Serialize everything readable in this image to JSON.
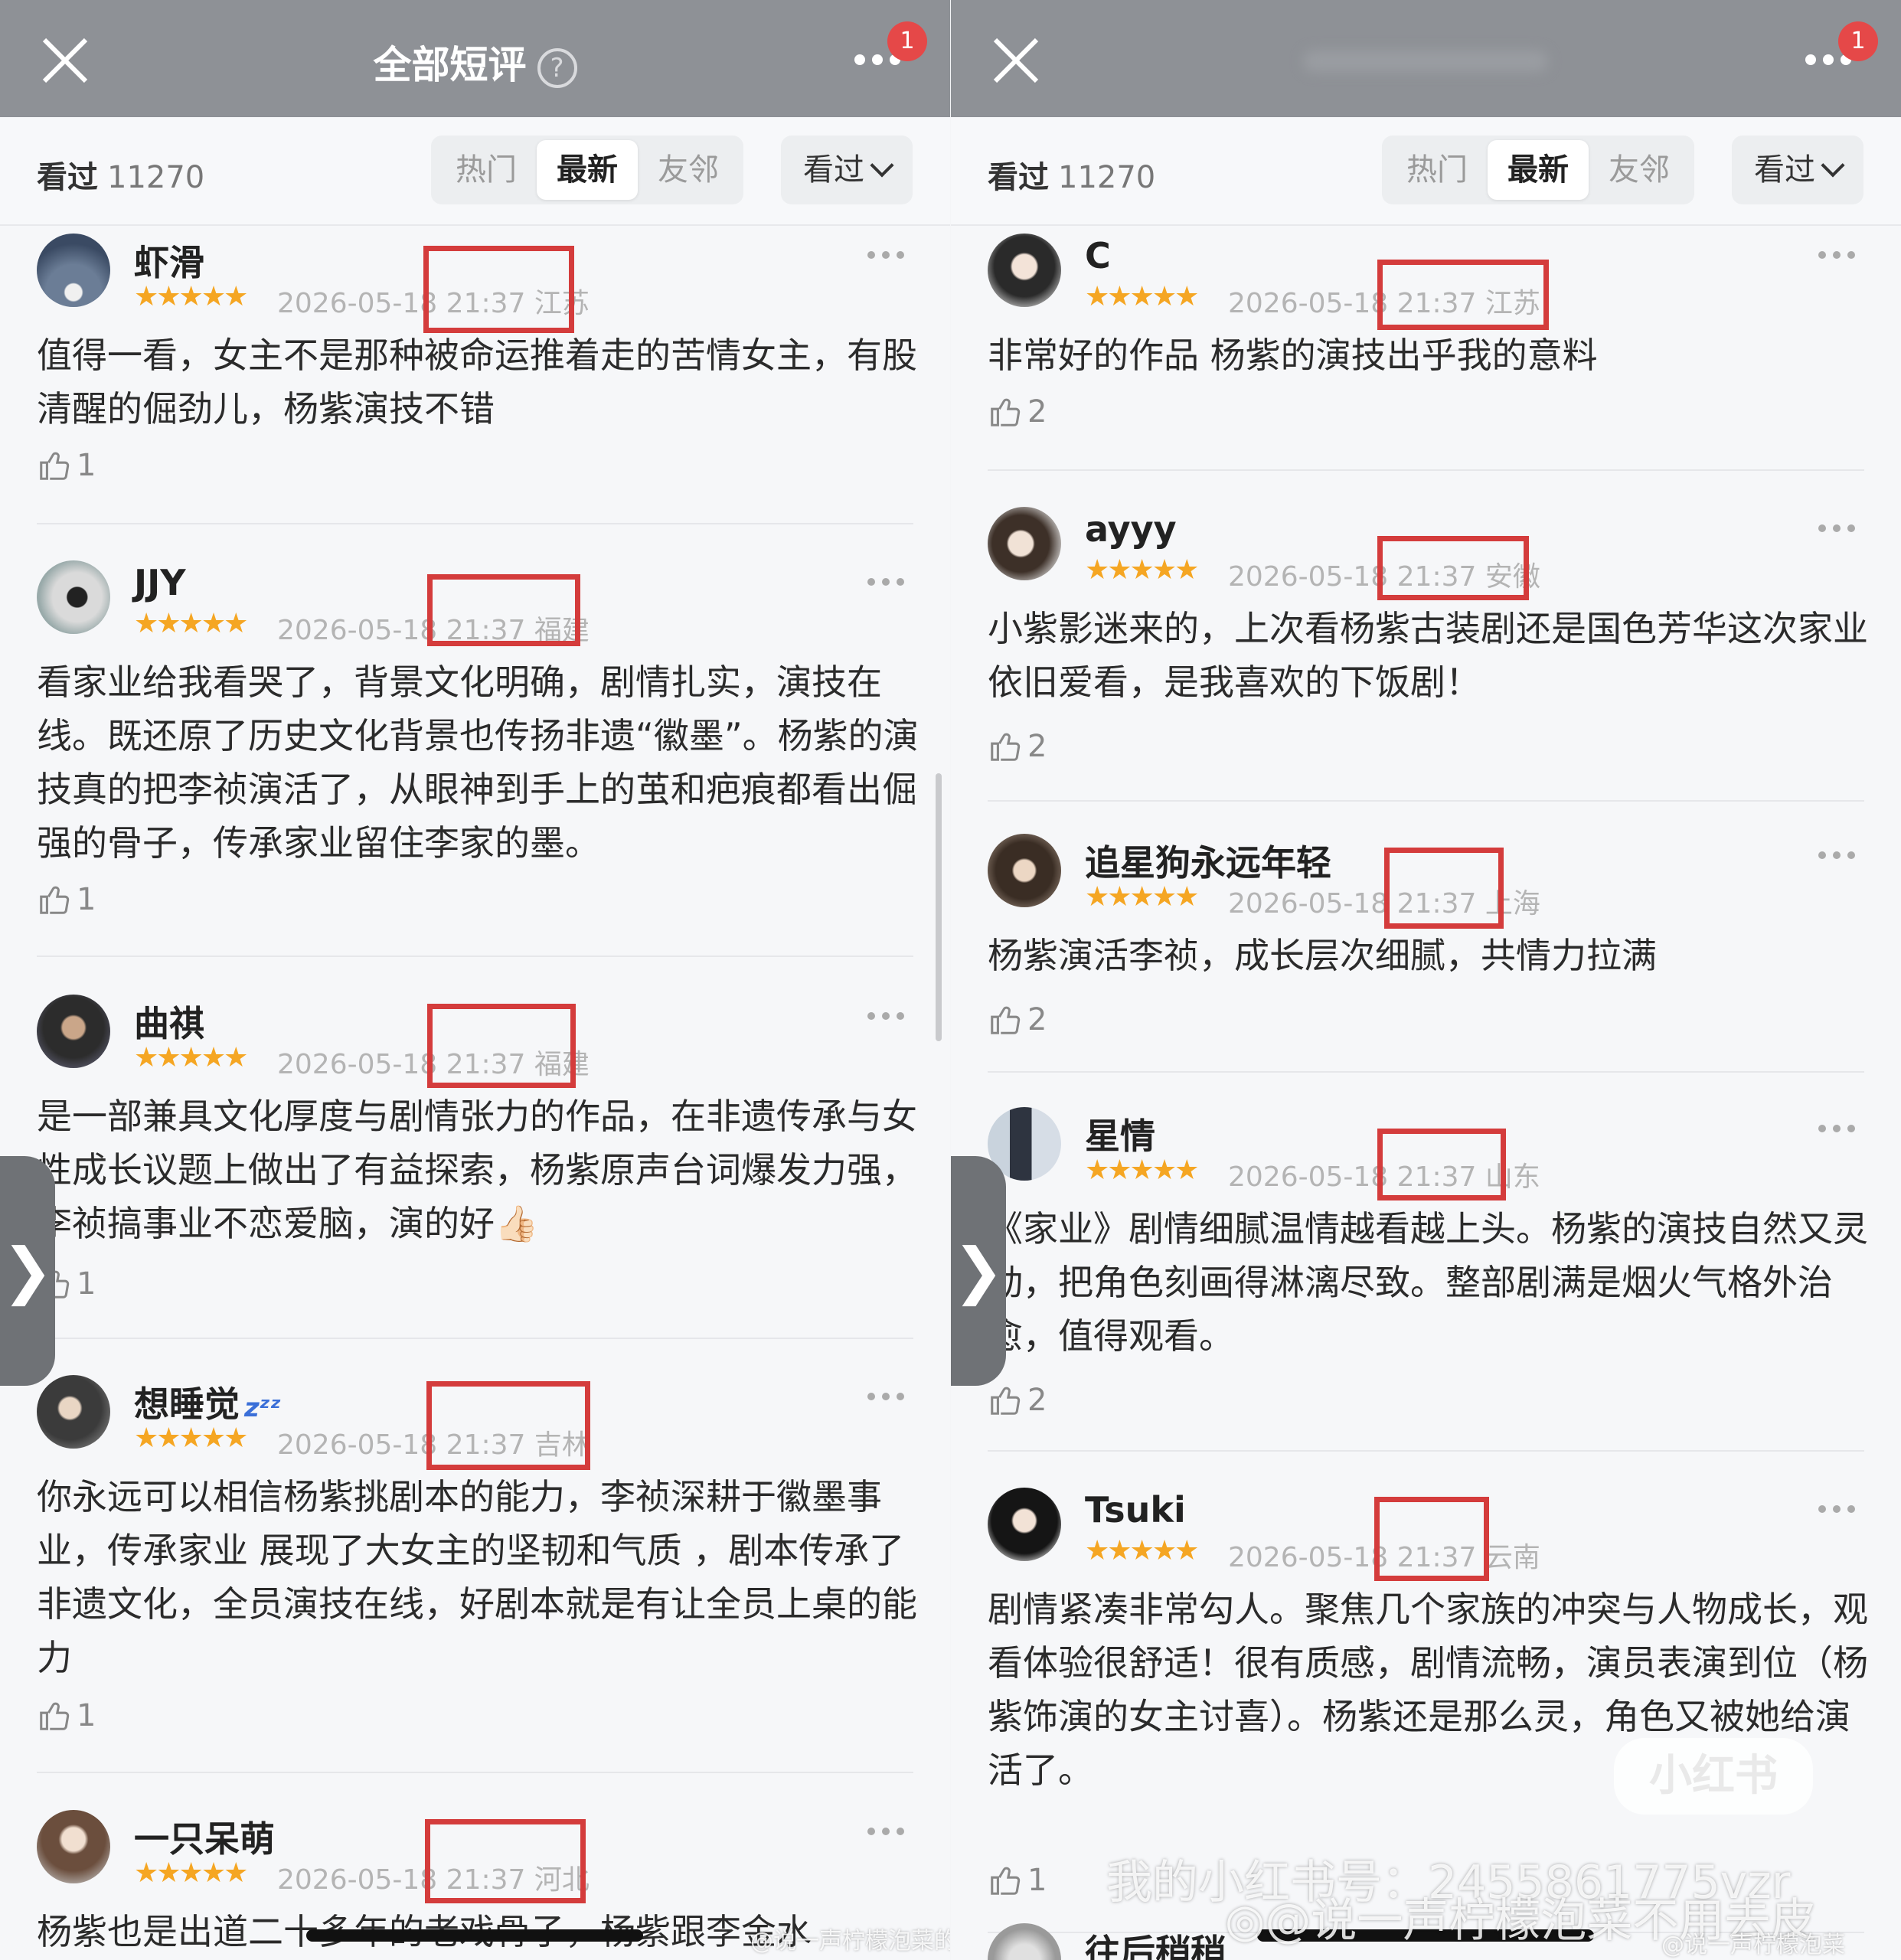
{
  "left_panel": {
    "title": "全部短评",
    "help": "?",
    "badge": "1",
    "watched_label": "看过",
    "watched_count": "11270",
    "tabs": [
      "热门",
      "最新",
      "友邻"
    ],
    "filter": "看过",
    "reviews": [
      {
        "name": "虾滑",
        "zzz": "",
        "stars": "★★★★★",
        "date": "2026-05-18",
        "time_loc": "21:37 江苏",
        "body": "值得一看，女主不是那种被命运推着走的苦情女主，有股清醒的倔劲儿，杨紫演技不错",
        "likes": "1"
      },
      {
        "name": "JJY",
        "zzz": "",
        "stars": "★★★★★",
        "date": "2026-05-18",
        "time_loc": "21:37 福建",
        "body": "看家业给我看哭了，背景文化明确，剧情扎实，演技在线。既还原了历史文化背景也传扬非遗“徽墨”。杨紫的演技真的把李祯演活了，从眼神到手上的茧和疤痕都看出倔强的骨子，传承家业留住李家的墨。",
        "likes": "1"
      },
      {
        "name": "曲祺",
        "zzz": "",
        "stars": "★★★★★",
        "date": "2026-05-18",
        "time_loc": "21:37 福建",
        "body": "是一部兼具文化厚度与剧情张力的作品，在非遗传承与女性成长议题上做出了有益探索，杨紫原声台词爆发力强，李祯搞事业不恋爱脑，演的好👍🏻",
        "likes": "1"
      },
      {
        "name": "想睡觉",
        "zzz": "zᶻᶻ",
        "stars": "★★★★★",
        "date": "2026-05-18",
        "time_loc": "21:37 吉林",
        "body": "你永远可以相信杨紫挑剧本的能力，李祯深耕于徽墨事业，传承家业 展现了大女主的坚韧和气质 ，剧本传承了非遗文化，全员演技在线，好剧本就是有让全员上桌的能力",
        "likes": "1"
      },
      {
        "name": "一只呆萌",
        "zzz": "",
        "stars": "★★★★★",
        "date": "2026-05-18",
        "time_loc": "21:37 河北",
        "body": "杨紫也是出道二十多年的老戏骨子，杨紫跟李金水",
        "likes": ""
      }
    ]
  },
  "right_panel": {
    "badge": "1",
    "watched_label": "看过",
    "watched_count": "11270",
    "tabs": [
      "热门",
      "最新",
      "友邻"
    ],
    "filter": "看过",
    "reviews": [
      {
        "name": "C",
        "stars": "★★★★★",
        "date": "2026-05-18",
        "time_loc": "21:37 江苏",
        "body": "非常好的作品 杨紫的演技出乎我的意料",
        "likes": "2"
      },
      {
        "name": "ayyy",
        "stars": "★★★★★",
        "date": "2026-05-18",
        "time_loc": "21:37 安徽",
        "body": "小紫影迷来的，上次看杨紫古装剧还是国色芳华这次家业依旧爱看，是我喜欢的下饭剧！",
        "likes": "2"
      },
      {
        "name": "追星狗永远年轻",
        "stars": "★★★★★",
        "date": "2026-05-18",
        "time_loc": "21:37 上海",
        "body": "杨紫演活李祯，成长层次细腻，共情力拉满",
        "likes": "2"
      },
      {
        "name": "星情",
        "stars": "★★★★★",
        "date": "2026-05-18",
        "time_loc": "21:37 山东",
        "body": "《家业》剧情细腻温情越看越上头。杨紫的演技自然又灵动，把角色刻画得淋漓尽致。整部剧满是烟火气格外治愈，值得观看。",
        "likes": "2"
      },
      {
        "name": "Tsuki",
        "stars": "★★★★★",
        "date": "2026-05-18",
        "time_loc": "21:37 云南",
        "body": "剧情紧凑非常勾人。聚焦几个家族的冲突与人物成长，观看体验很舒适！很有质感，剧情流畅，演员表演到位（杨紫饰演的女主讨喜）。杨紫还是那么灵，角色又被她给演活了。",
        "likes": "1"
      },
      {
        "name": "往后稍稍",
        "stars": "",
        "date": "",
        "time_loc": "",
        "body": "",
        "likes": ""
      }
    ]
  },
  "watermarks": {
    "xhs_id": "我的小红书号：2455861775vzr",
    "weibo": "@说一声柠檬泡菜不用去皮",
    "weibo_small_left": "@说一声柠檬泡菜的祖宗",
    "weibo_small_right": "@说一声柠檬泡菜",
    "xhs_logo": "小红书"
  },
  "side_arrow": "❯"
}
